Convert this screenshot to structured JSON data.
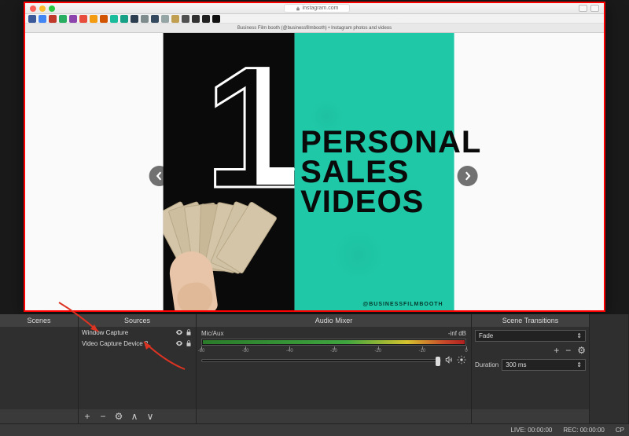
{
  "browser": {
    "address": "instagram.com",
    "tab_title": "Business Film booth (@businessfilmbooth) • Instagram photos and videos",
    "bookmark_colors": [
      "#3b5998",
      "#4285f4",
      "#c0392b",
      "#27ae60",
      "#8e44ad",
      "#e74c3c",
      "#f39c12",
      "#d35400",
      "#1abc9c",
      "#16a085",
      "#2c3e50",
      "#7f8c8d",
      "#34495e",
      "#95a5a6",
      "#c0a050",
      "#505050",
      "#303030",
      "#202020",
      "#101010"
    ]
  },
  "post": {
    "big_number": "1",
    "line1": "PERSONAL",
    "line2": "SALES",
    "line3": "VIDEOS",
    "handle": "@BUSINESSFILMBOOTH"
  },
  "panels": {
    "scenes_title": "Scenes",
    "sources_title": "Sources",
    "mixer_title": "Audio Mixer",
    "transitions_title": "Scene Transitions"
  },
  "sources": [
    {
      "name": "Window Capture"
    },
    {
      "name": "Video Capture Device 2"
    }
  ],
  "mixer": {
    "channel": "Mic/Aux",
    "level": "-inf dB",
    "ticks": [
      "-60",
      "-50",
      "-40",
      "-30",
      "-20",
      "-10",
      "0"
    ]
  },
  "transitions": {
    "selected": "Fade",
    "duration_label": "Duration",
    "duration_value": "300 ms"
  },
  "status": {
    "live": "LIVE: 00:00:00",
    "rec": "REC: 00:00:00",
    "cpu": "CP"
  },
  "footer_btns": {
    "add": "+",
    "remove": "−",
    "gear": "⚙",
    "up": "∧",
    "down": "∨"
  }
}
